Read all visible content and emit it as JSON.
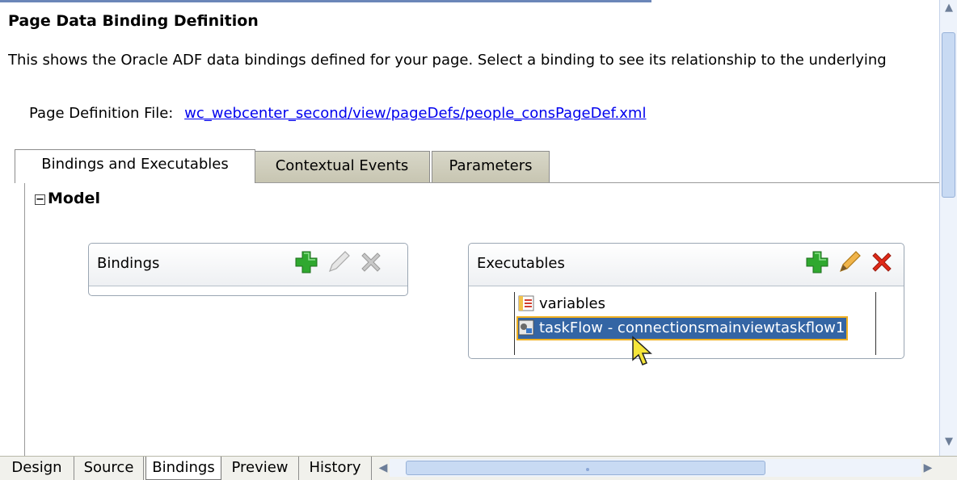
{
  "heading": "Page Data Binding Definition",
  "intro": "This shows the Oracle ADF data bindings defined for your page. Select a binding to see its relationship to the underlying",
  "page_definition": {
    "label": "Page Definition File:",
    "link": "wc_webcenter_second/view/pageDefs/people_consPageDef.xml"
  },
  "tabs": [
    {
      "label": "Bindings and Executables",
      "active": true
    },
    {
      "label": "Contextual Events",
      "active": false
    },
    {
      "label": "Parameters",
      "active": false
    }
  ],
  "model": {
    "label": "Model",
    "toggle": "−"
  },
  "bindings": {
    "title": "Bindings",
    "icons": [
      "add-icon",
      "edit-icon",
      "delete-icon"
    ],
    "items": []
  },
  "executables": {
    "title": "Executables",
    "icons": [
      "add-icon",
      "edit-icon",
      "delete-icon"
    ],
    "items": [
      {
        "label": "variables",
        "icon": "variables-icon",
        "selected": false
      },
      {
        "label": "taskFlow - connectionsmainviewtaskflow1",
        "icon": "taskflow-icon",
        "selected": true
      }
    ]
  },
  "bottom_tabs": [
    {
      "label": "Design",
      "active": false
    },
    {
      "label": "Source",
      "active": false
    },
    {
      "label": "Bindings",
      "active": true
    },
    {
      "label": "Preview",
      "active": false
    },
    {
      "label": "History",
      "active": false
    }
  ],
  "colors": {
    "accent": "#3465a4",
    "link": "#0000ee",
    "add": "#2fa82f",
    "delete": "#e02a18",
    "edit": "#d9a02c"
  }
}
